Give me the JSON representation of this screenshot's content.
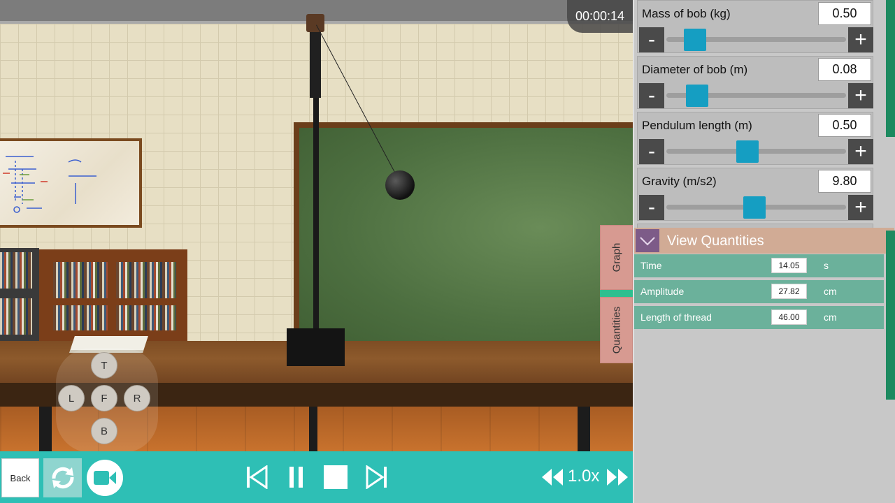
{
  "timer": "00:00:14",
  "nav_pad": {
    "top": "T",
    "left": "L",
    "front": "F",
    "right": "R",
    "bottom": "B"
  },
  "bottom_bar": {
    "back_label": "Back",
    "speed": "1.0x"
  },
  "parameters": [
    {
      "label": "Mass of bob (kg)",
      "value": "0.50",
      "slider_fraction": 0.16
    },
    {
      "label": "Diameter of bob (m)",
      "value": "0.08",
      "slider_fraction": 0.17
    },
    {
      "label": "Pendulum length (m)",
      "value": "0.50",
      "slider_fraction": 0.45
    },
    {
      "label": "Gravity (m/s2)",
      "value": "9.80",
      "slider_fraction": 0.49
    }
  ],
  "side_tabs": {
    "graph": "Graph",
    "quantities": "Quantities"
  },
  "view_quantities": {
    "title": "View Quantities",
    "rows": [
      {
        "name": "Time",
        "value": "14.05",
        "unit": "s"
      },
      {
        "name": "Amplitude",
        "value": "27.82",
        "unit": "cm"
      },
      {
        "name": "Length of thread",
        "value": "46.00",
        "unit": "cm"
      }
    ]
  },
  "colors": {
    "accent_teal": "#2ebfb5",
    "slider_thumb": "#159ec2",
    "quantity_row": "#6bb19b",
    "scrollbar": "#1d8a60"
  },
  "icons": {
    "reset": "refresh-icon",
    "camera": "video-camera-icon",
    "skip_back": "skip-back-icon",
    "pause": "pause-icon",
    "stop": "stop-icon",
    "skip_forward": "skip-forward-icon",
    "slower": "rewind-icon",
    "faster": "fast-forward-icon"
  }
}
